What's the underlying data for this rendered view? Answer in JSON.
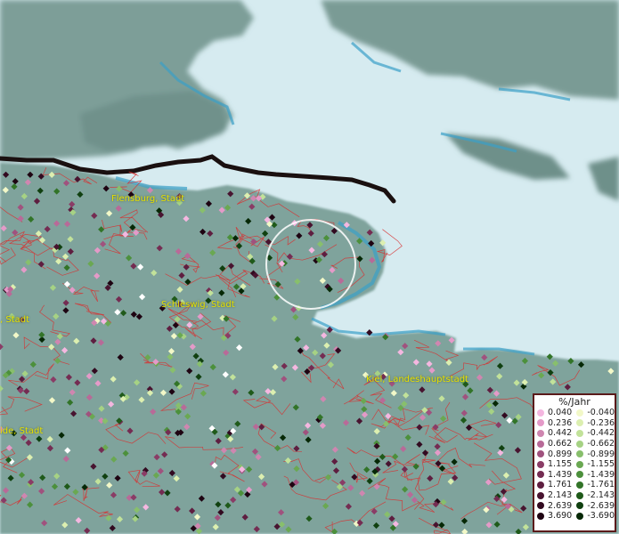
{
  "map": {
    "places": [
      {
        "id": "flensburg",
        "label": "Flensburg, Stadt"
      },
      {
        "id": "schleswig",
        "label": "Schleswig, Stadt"
      },
      {
        "id": "kiel",
        "label": "Kiel, Landeshauptstadt"
      },
      {
        "id": "left1",
        "label": ", Stadt"
      },
      {
        "id": "left2",
        "label": "ide, Stadt"
      }
    ],
    "colors": {
      "water": "#d6ebf0",
      "land": "#7fa39c",
      "shallow": "#3aa0c8",
      "border": "#1a1010",
      "district": "#d83030"
    }
  },
  "legend": {
    "title": "%/Jahr",
    "positive": [
      {
        "value": "0.040",
        "color": "#f4b7e0"
      },
      {
        "value": "0.236",
        "color": "#e49ac8"
      },
      {
        "value": "0.442",
        "color": "#cf86b0"
      },
      {
        "value": "0.662",
        "color": "#b86a98"
      },
      {
        "value": "0.899",
        "color": "#a0527e"
      },
      {
        "value": "1.155",
        "color": "#8a3c66"
      },
      {
        "value": "1.439",
        "color": "#742c52"
      },
      {
        "value": "1.761",
        "color": "#5e1e40"
      },
      {
        "value": "2.143",
        "color": "#481430"
      },
      {
        "value": "2.639",
        "color": "#320a20"
      },
      {
        "value": "3.690",
        "color": "#1e0412"
      }
    ],
    "negative": [
      {
        "value": "-0.040",
        "color": "#f2f8c8"
      },
      {
        "value": "-0.236",
        "color": "#dcefb0"
      },
      {
        "value": "-0.442",
        "color": "#c2e29a"
      },
      {
        "value": "-0.662",
        "color": "#a6d284"
      },
      {
        "value": "-0.899",
        "color": "#88bf6c"
      },
      {
        "value": "-1.155",
        "color": "#6aa852"
      },
      {
        "value": "-1.439",
        "color": "#4c903c"
      },
      {
        "value": "-1.761",
        "color": "#327428"
      },
      {
        "value": "-2.143",
        "color": "#1f5a1a"
      },
      {
        "value": "-2.639",
        "color": "#104010"
      },
      {
        "value": "-3.690",
        "color": "#062806"
      }
    ]
  }
}
